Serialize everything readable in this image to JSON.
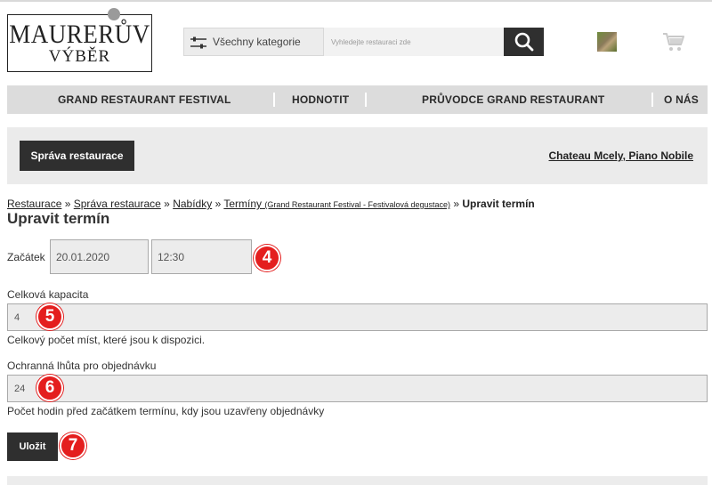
{
  "header": {
    "logo_line1": "MAURERŮV",
    "logo_line2": "VÝBĚR",
    "category_select": "Všechny kategorie",
    "search_placeholder": "Vyhledejte restauraci zde"
  },
  "nav": {
    "items": [
      {
        "label": "GRAND RESTAURANT FESTIVAL"
      },
      {
        "label": "HODNOTIT"
      },
      {
        "label": "PRŮVODCE GRAND RESTAURANT"
      },
      {
        "label": "O NÁS"
      }
    ]
  },
  "admin": {
    "manage_button": "Správa restaurace",
    "restaurant_name": "Chateau Mcely, Piano Nobile"
  },
  "breadcrumb": {
    "items": [
      "Restaurace",
      "Správa restaurace",
      "Nabídky",
      "Termíny"
    ],
    "separator": "»",
    "detail": "(Grand Restaurant Festival - Festivalová degustace)",
    "current": "Upravit termín"
  },
  "page": {
    "title": "Upravit termín"
  },
  "form": {
    "start_label": "Začátek",
    "start_date": "20.01.2020",
    "start_time": "12:30",
    "capacity_label": "Celková kapacita",
    "capacity_value": "4",
    "capacity_help": "Celkový počet míst, které jsou k dispozici.",
    "deadline_label": "Ochranná lhůta pro objednávku",
    "deadline_value": "24",
    "deadline_help": "Počet hodin před začátkem termínu, kdy jsou uzavřeny objednávky",
    "save_button": "Uložit"
  },
  "annotations": {
    "badge_4": "4",
    "badge_5": "5",
    "badge_6": "6",
    "badge_7": "7"
  },
  "colors": {
    "dark_button": "#2f2f2f",
    "nav_bg": "#dcdcdc",
    "annotation_red": "#e41e1e"
  }
}
